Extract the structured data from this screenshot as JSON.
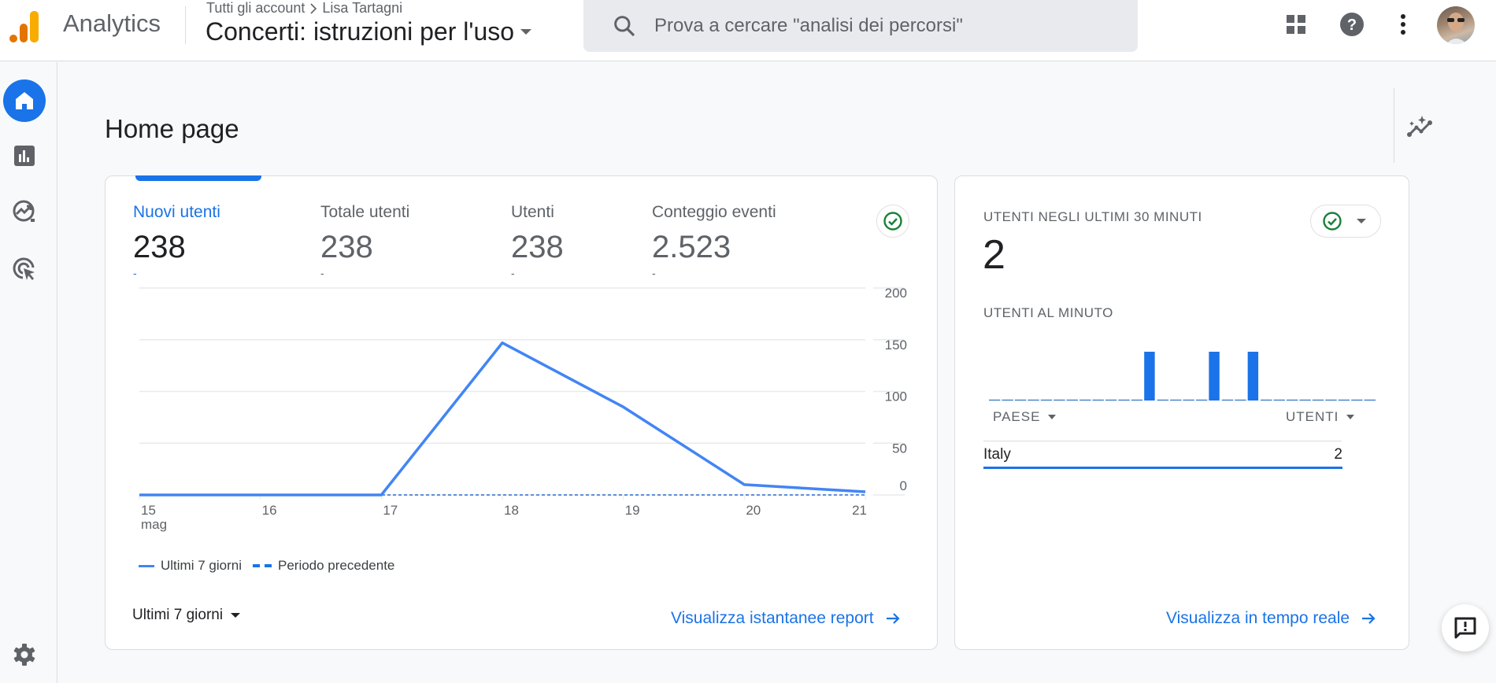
{
  "header": {
    "app_name": "Analytics",
    "breadcrumb": {
      "root": "Tutti gli account",
      "separator": ">",
      "account": "Lisa Tartagni"
    },
    "property_name": "Concerti: istruzioni per l'uso",
    "search_placeholder": "Prova a cercare \"analisi dei percorsi\"",
    "icons": [
      "apps-grid-icon",
      "help-icon",
      "more-vert-icon",
      "avatar"
    ]
  },
  "sidebar": {
    "items": [
      {
        "name": "home",
        "icon": "home-icon",
        "active": true
      },
      {
        "name": "reports",
        "icon": "bar-chart-icon",
        "active": false
      },
      {
        "name": "explore",
        "icon": "explore-trend-icon",
        "active": false
      },
      {
        "name": "advertising",
        "icon": "target-cursor-icon",
        "active": false
      }
    ],
    "bottom_icon": "settings-gear-icon"
  },
  "page": {
    "title": "Home page",
    "insights_icon": "insights-sparkle-icon"
  },
  "overview_card": {
    "metrics": [
      {
        "label": "Nuovi utenti",
        "value": "238",
        "change": "-",
        "active": true
      },
      {
        "label": "Totale utenti",
        "value": "238",
        "change": "-",
        "active": false
      },
      {
        "label": "Utenti",
        "value": "238",
        "change": "-",
        "active": false
      },
      {
        "label": "Conteggio eventi",
        "value": "2.523",
        "change": "-",
        "active": false
      }
    ],
    "legend": {
      "current": "Ultimi 7 giorni",
      "previous": "Periodo precedente"
    },
    "date_range": "Ultimi 7 giorni",
    "link": "Visualizza istantanee report",
    "status_color": "#188038"
  },
  "chart_data": {
    "type": "line",
    "title": "Nuovi utenti",
    "x": [
      "15",
      "16",
      "17",
      "18",
      "19",
      "20",
      "21"
    ],
    "x_sublabel_first": "mag",
    "series": [
      {
        "name": "Ultimi 7 giorni",
        "style": "solid",
        "values": [
          0,
          0,
          0,
          147,
          85,
          10,
          3
        ]
      },
      {
        "name": "Periodo precedente",
        "style": "dashed",
        "values": [
          0,
          0,
          0,
          0,
          0,
          0,
          0
        ]
      }
    ],
    "yticks": [
      "200",
      "150",
      "100",
      "50",
      "0"
    ],
    "ylim": [
      0,
      200
    ],
    "y_axis_side": "right",
    "grid": true,
    "legend": "bottom-left",
    "color": "#4285f4"
  },
  "realtime_card": {
    "title": "UTENTI NEGLI ULTIMI 30 MINUTI",
    "value": "2",
    "per_minute_label": "UTENTI AL MINUTO",
    "per_minute": [
      0,
      0,
      0,
      0,
      0,
      0,
      0,
      0,
      0,
      0,
      0,
      0,
      1,
      0,
      0,
      0,
      0,
      1,
      0,
      0,
      1,
      0,
      0,
      0,
      0,
      0,
      0,
      0,
      0,
      0
    ],
    "table": {
      "columns": [
        "PAESE",
        "UTENTI"
      ],
      "rows": [
        {
          "country": "Italy",
          "users": "2"
        }
      ]
    },
    "link": "Visualizza in tempo reale",
    "bar_color": "#1a73e8"
  },
  "feedback_icon": "feedback-icon"
}
